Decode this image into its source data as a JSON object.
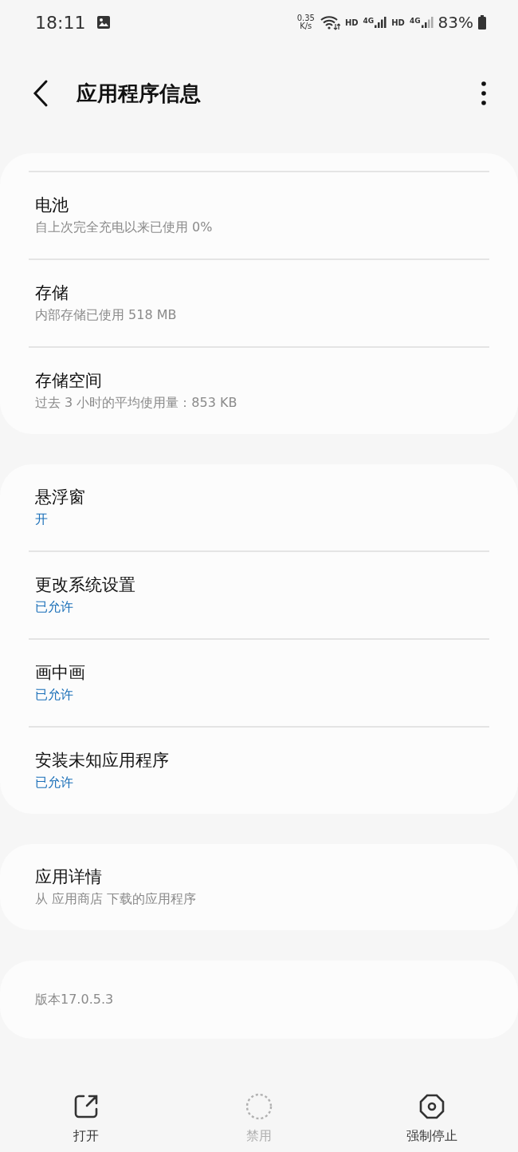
{
  "status_bar": {
    "time": "18:11",
    "speed_value": "0.35",
    "speed_unit": "K/s",
    "hd_1": "HD",
    "net_1": "4G",
    "hd_2": "HD",
    "net_2": "4G",
    "battery": "83%"
  },
  "header": {
    "title": "应用程序信息"
  },
  "cards": [
    {
      "top_divider": true,
      "rows": [
        {
          "title": "电池",
          "subtitle": "自上次完全充电以来已使用 0%",
          "kind": "info"
        },
        {
          "title": "存储",
          "subtitle": "内部存储已使用 518 MB",
          "kind": "info"
        },
        {
          "title": "存储空间",
          "subtitle": "过去 3 小时的平均使用量：853 KB",
          "kind": "info"
        }
      ]
    },
    {
      "top_divider": false,
      "rows": [
        {
          "title": "悬浮窗",
          "subtitle": "开",
          "kind": "status"
        },
        {
          "title": "更改系统设置",
          "subtitle": "已允许",
          "kind": "status"
        },
        {
          "title": "画中画",
          "subtitle": "已允许",
          "kind": "status"
        },
        {
          "title": "安装未知应用程序",
          "subtitle": "已允许",
          "kind": "status"
        }
      ]
    },
    {
      "top_divider": false,
      "rows": [
        {
          "title": "应用详情",
          "subtitle": "从 应用商店 下载的应用程序",
          "kind": "info"
        }
      ]
    },
    {
      "top_divider": false,
      "rows": [
        {
          "subtitle": "版本17.0.5.3",
          "kind": "info"
        }
      ]
    }
  ],
  "actions": [
    {
      "label": "打开",
      "kind": "open",
      "disabled": false
    },
    {
      "label": "禁用",
      "kind": "disable",
      "disabled": true
    },
    {
      "label": "强制停止",
      "kind": "stop",
      "disabled": false
    }
  ]
}
